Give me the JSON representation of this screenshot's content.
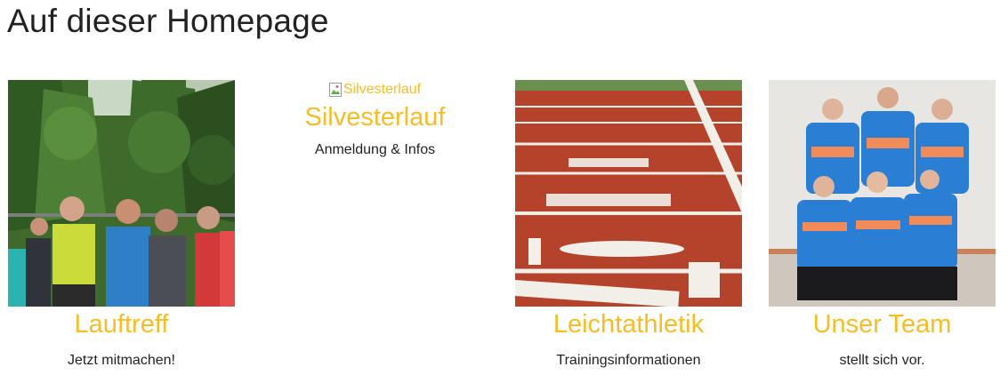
{
  "page": {
    "heading": "Auf dieser Homepage"
  },
  "cards": [
    {
      "title": "Lauftreff",
      "text": "Jetzt mitmachen!",
      "image_alt": "Lauftreff"
    },
    {
      "title": "Silvesterlauf",
      "text": "Anmeldung & Infos",
      "image_alt": "Silvesterlauf"
    },
    {
      "title": "Leichtathletik",
      "text": "Trainingsinformationen",
      "image_alt": "Leichtathletik"
    },
    {
      "title": "Unser Team",
      "text": "stellt sich vor.",
      "image_alt": "Unser Team"
    }
  ],
  "colors": {
    "accent": "#f7bd26",
    "text": "#222222",
    "track": "#b5432c",
    "jersey": "#2a7fd4"
  }
}
